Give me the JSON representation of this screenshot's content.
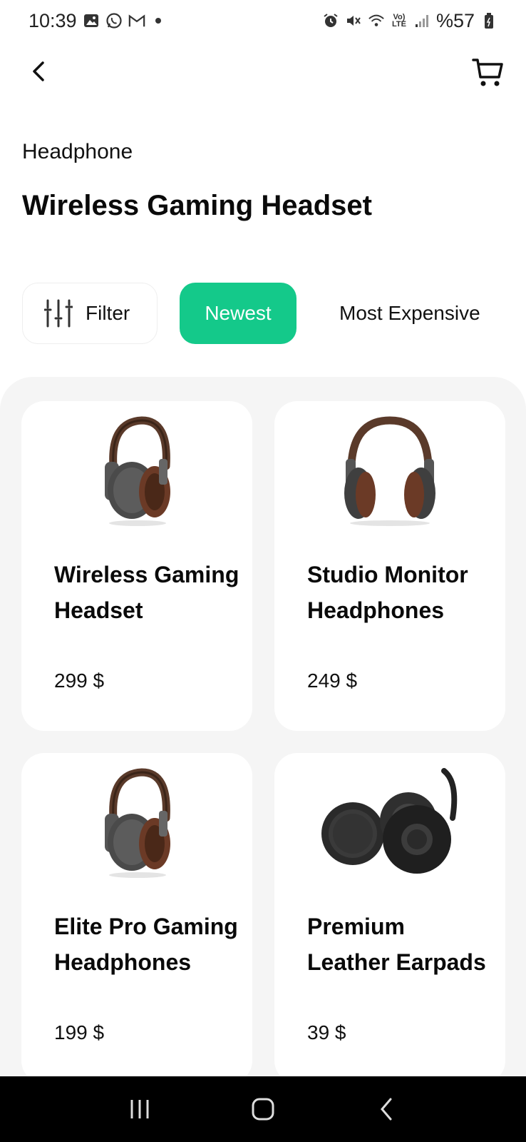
{
  "status_bar": {
    "time": "10:39",
    "battery": "%57",
    "left_icons": [
      "gallery-icon",
      "whatsapp-icon",
      "gmail-icon",
      "notification-dot"
    ],
    "right_icons": [
      "alarm-icon",
      "mute-icon",
      "wifi-icon",
      "volte-icon",
      "signal-icon",
      "battery-icon"
    ]
  },
  "header": {
    "back_icon": "chevron-left-icon",
    "cart_icon": "cart-icon"
  },
  "category": "Headphone",
  "title": "Wireless Gaming Headset",
  "sort_bar": {
    "filter_label": "Filter",
    "filter_icon": "sliders-icon",
    "newest_label": "Newest",
    "expensive_label": "Most Expensive",
    "active": "Newest"
  },
  "products": [
    {
      "name": "Wireless Gaming Headset",
      "price": "299 $",
      "image": "headphone-side-icon"
    },
    {
      "name": "Studio Monitor Headphones",
      "price": "249 $",
      "image": "headphone-front-icon"
    },
    {
      "name": "Elite Pro Gaming Headphones",
      "price": "199 $",
      "image": "headphone-side-icon"
    },
    {
      "name": "Premium Leather Earpads",
      "price": "39 $",
      "image": "earpads-icon"
    }
  ],
  "nav_bar": {
    "buttons": [
      "recent-apps-icon",
      "home-icon",
      "back-icon"
    ]
  },
  "colors": {
    "accent": "#14c98a",
    "background": "#ffffff",
    "products_bg": "#f5f5f5",
    "nav_bar": "#000000"
  }
}
